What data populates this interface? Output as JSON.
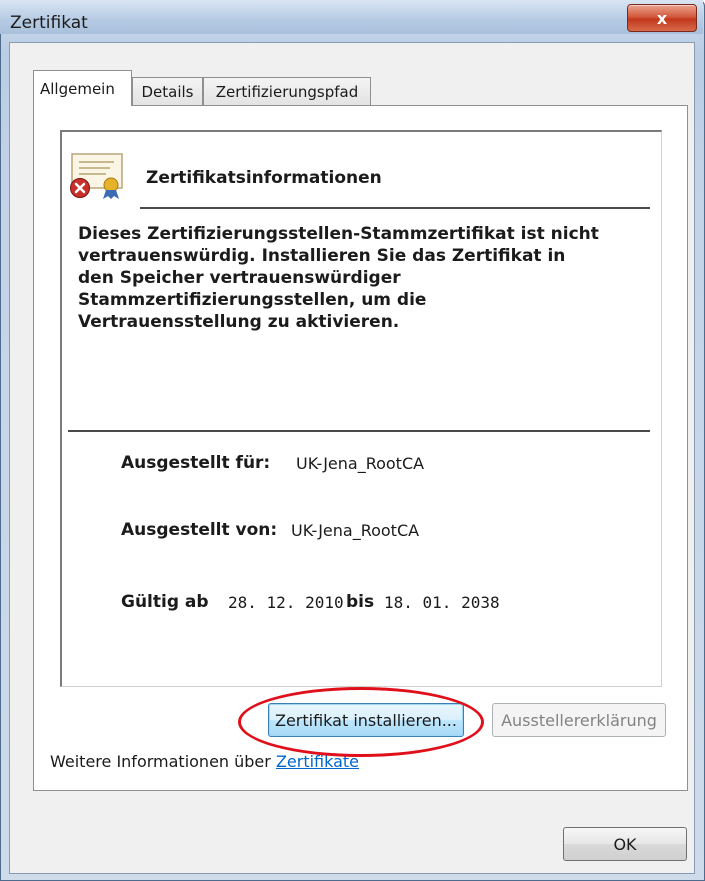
{
  "window": {
    "title": "Zertifikat",
    "close_glyph": "x"
  },
  "tabs": [
    {
      "label": "Allgemein",
      "active": true
    },
    {
      "label": "Details",
      "active": false
    },
    {
      "label": "Zertifizierungspfad",
      "active": false
    }
  ],
  "certificate": {
    "icon": "certificate-error-icon",
    "info_title": "Zertifikatsinformationen",
    "warning_lines": [
      "Dieses Zertifizierungsstellen-Stammzertifikat ist nicht",
      "vertrauenswürdig. Installieren Sie das Zertifikat in",
      "den Speicher vertrauenswürdiger",
      "Stammzertifizierungsstellen, um die",
      "Vertrauensstellung zu aktivieren."
    ],
    "issued_to_label": "Ausgestellt für:",
    "issued_to_value": "UK-Jena_RootCA",
    "issued_by_label": "Ausgestellt von:",
    "issued_by_value": "UK-Jena_RootCA",
    "valid_from_label": "Gültig ab",
    "valid_from_value": "28. 12. 2010",
    "valid_to_label": "bis",
    "valid_to_value": "18. 01. 2038"
  },
  "buttons": {
    "install": "Zertifikat installieren...",
    "issuer_statement": "Ausstellererklärung",
    "ok": "OK"
  },
  "more_info": {
    "text": "Weitere Informationen über ",
    "link": "Zertifikate"
  },
  "colors": {
    "highlight": "#e0101a",
    "link": "#0066cc",
    "close_button": "#c2381c"
  }
}
